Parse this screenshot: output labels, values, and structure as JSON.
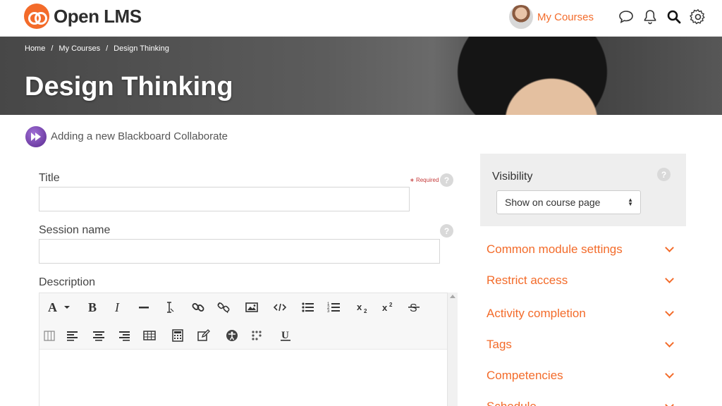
{
  "brand": {
    "name": "Open LMS",
    "accent": "#f36b2a"
  },
  "nav": {
    "my_courses_label": "My Courses",
    "icons": [
      "chat-icon",
      "bell-icon",
      "search-icon",
      "gear-icon"
    ]
  },
  "breadcrumb": [
    "Home",
    "My Courses",
    "Design Thinking"
  ],
  "breadcrumb_separator": "/",
  "course_title": "Design Thinking",
  "activity_heading": "Adding a new Blackboard Collaborate",
  "form": {
    "title_label": "Title",
    "required_label": "Required",
    "session_name_label": "Session name",
    "description_label": "Description",
    "help_glyph": "?"
  },
  "editor": {
    "toolbar_row1": [
      "font-family",
      "bold",
      "italic",
      "horizontal-rule",
      "clear-formatting",
      "link",
      "unlink",
      "image",
      "html-source",
      "bullet-list",
      "numbered-list",
      "subscript",
      "superscript",
      "strikethrough"
    ],
    "toolbar_row2": [
      "table-columns",
      "align-left",
      "align-center",
      "align-right",
      "table",
      "calculator",
      "edit",
      "accessibility",
      "screenreader",
      "underline"
    ]
  },
  "sidebar": {
    "visibility_label": "Visibility",
    "visibility_value": "Show on course page",
    "sections": [
      "Common module settings",
      "Restrict access",
      "Activity completion",
      "Tags",
      "Competencies",
      "Schedule"
    ]
  }
}
